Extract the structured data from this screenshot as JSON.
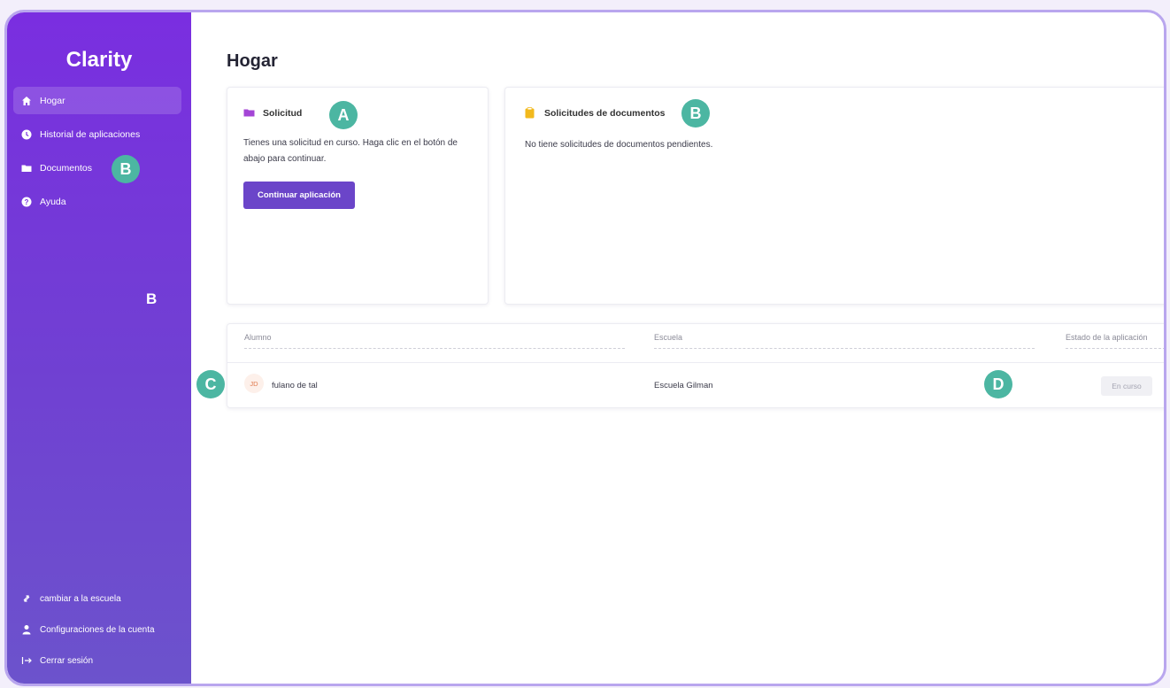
{
  "brand": "Clarity",
  "sidebar": {
    "items": [
      {
        "label": "Hogar",
        "icon": "home-icon",
        "active": true
      },
      {
        "label": "Historial de aplicaciones",
        "icon": "clock-icon"
      },
      {
        "label": "Documentos",
        "icon": "folder-icon"
      },
      {
        "label": "Ayuda",
        "icon": "help-icon"
      }
    ],
    "bottom": [
      {
        "label": "cambiar a la escuela",
        "icon": "switch-icon"
      },
      {
        "label": "Configuraciones de la cuenta",
        "icon": "user-icon"
      },
      {
        "label": "Cerrar sesión",
        "icon": "logout-icon"
      }
    ]
  },
  "page": {
    "title": "Hogar"
  },
  "solicitud": {
    "title": "Solicitud",
    "text": "Tienes una solicitud en curso. Haga clic en el botón de abajo para continuar.",
    "button": "Continuar aplicación"
  },
  "documentos": {
    "title": "Solicitudes de documentos",
    "text": "No tiene solicitudes de documentos pendientes."
  },
  "table": {
    "headers": [
      "Alumno",
      "Escuela",
      "Estado de la aplicación"
    ],
    "rows": [
      {
        "initials": "JD",
        "student": "fulano de tal",
        "school": "Escuela Gilman",
        "status": "En curso"
      }
    ]
  },
  "markers": {
    "a": "A",
    "b": "B",
    "c": "C",
    "d": "D"
  },
  "colors": {
    "sidebar": "#7a2ee0",
    "accent": "#6b45c9",
    "marker": "#4cb6a2"
  }
}
